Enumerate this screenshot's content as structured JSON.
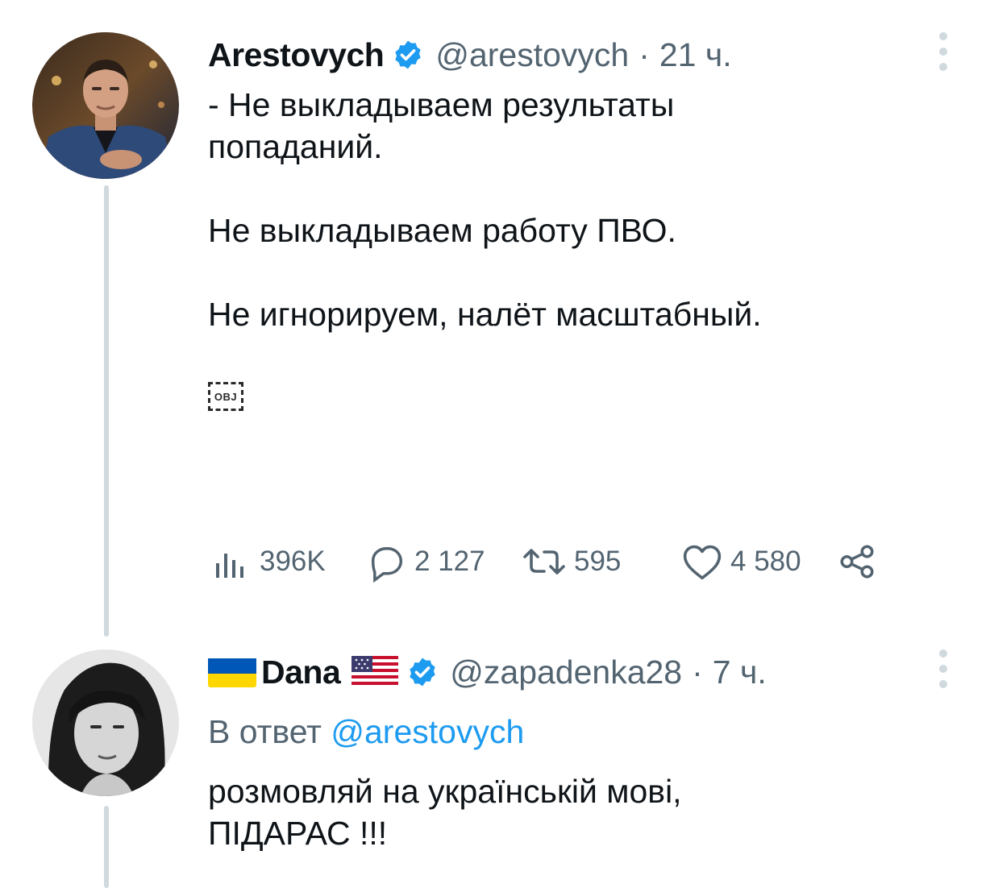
{
  "tweets": [
    {
      "author": {
        "display_name": "Arestovych",
        "handle": "@arestovych",
        "verified": true
      },
      "time": "21 ч.",
      "text": "- Не выкладываем результаты\nпопаданий.\n\nНе выкладываем работу ПВО.\n\nНе игнорируем, налёт масштабный.",
      "media_placeholder": "OBJ",
      "stats": {
        "views": "396K",
        "replies": "2 127",
        "retweets": "595",
        "likes": "4 580"
      }
    },
    {
      "author": {
        "display_name": "Dana",
        "handle": "@zapadenka28",
        "verified": true,
        "name_prefix_emoji": "ukraine-flag",
        "name_suffix_emoji": "us-flag"
      },
      "time": "7 ч.",
      "reply_label": "В ответ",
      "reply_mention": "@arestovych",
      "text": "розмовляй на українській мові,\nПІДАРАС !!!"
    }
  ],
  "separator": "·",
  "colors": {
    "primary_text": "#0f1419",
    "secondary_text": "#536471",
    "link": "#1d9bf0",
    "verified": "#1d9bf0",
    "thread_line": "#cfd9de"
  }
}
